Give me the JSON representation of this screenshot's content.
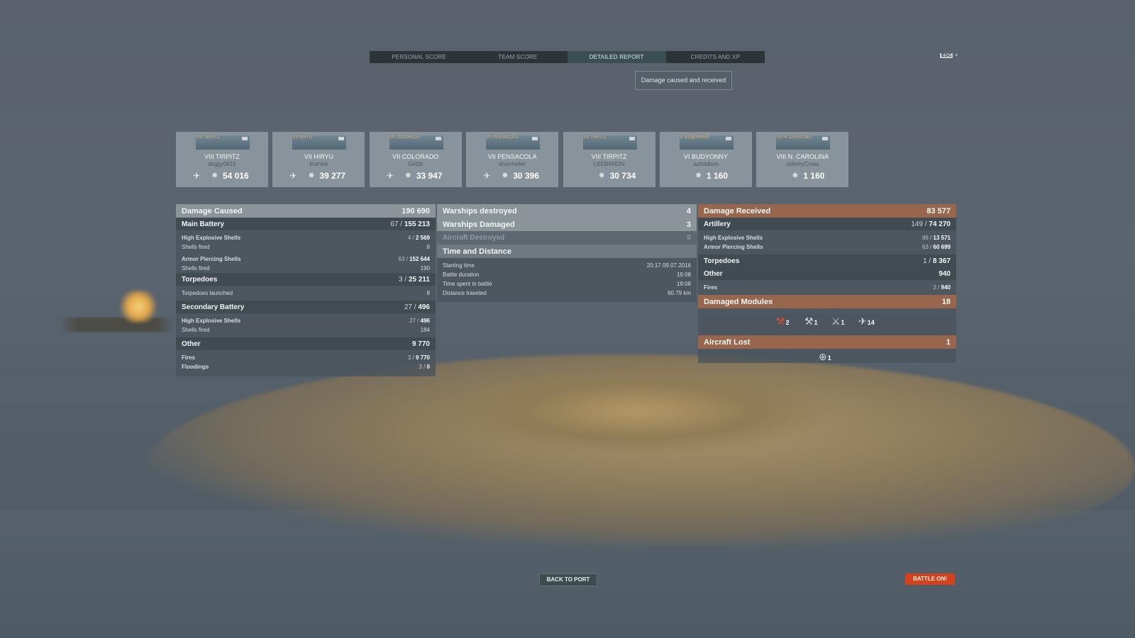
{
  "tabs": [
    "PERSONAL SCORE",
    "TEAM SCORE",
    "DETAILED REPORT",
    "CREDITS AND XP"
  ],
  "active_tab": "DETAILED REPORT",
  "esc_label": "ESC",
  "close_glyph": "×",
  "subtitle": "Damage caused and received",
  "cards": [
    {
      "ship": "VIII TIRPITZ",
      "player": "doggy0815",
      "damage": "54 016",
      "thumb_name": "VIII TIRPITZ"
    },
    {
      "ship": "VII HIRYU",
      "player": "frutnick",
      "damage": "39 277",
      "thumb_name": "VII HIRYU"
    },
    {
      "ship": "VII COLORADO",
      "player": "Girl2k",
      "damage": "33 947",
      "thumb_name": "VII COLORADO"
    },
    {
      "ship": "VII PENSACOLA",
      "player": "drumheller",
      "damage": "30 396",
      "thumb_name": "VII PENSACOLA"
    },
    {
      "ship": "VIII TIRPITZ",
      "player": "LEEBANON",
      "damage": "30 734",
      "thumb_name": "VIII TIRPITZ"
    },
    {
      "ship": "VI BUDYONNY",
      "player": "astradium",
      "damage": "1 160",
      "thumb_name": "VI БУДЕННЫЙ"
    },
    {
      "ship": "VIII N. CAROLINA",
      "player": "JohnnyCross",
      "damage": "1 160",
      "thumb_name": "VIII N. CAROLINA"
    }
  ],
  "damage_caused": {
    "label": "Damage Caused",
    "value": "190 690",
    "main_battery": {
      "label": "Main Battery",
      "hits": "67 /",
      "value": "155 213"
    },
    "he_shells": {
      "label": "High Explosive Shells",
      "hits": "4 /",
      "value": "2 569"
    },
    "he_fired": {
      "label": "Shells fired",
      "value": "8"
    },
    "ap_shells": {
      "label": "Armor Piercing Shells",
      "hits": "63 /",
      "value": "152 644"
    },
    "ap_fired": {
      "label": "Shells fired",
      "value": "190"
    },
    "torpedoes": {
      "label": "Torpedoes",
      "hits": "3 /",
      "value": "25 211"
    },
    "torp_launched": {
      "label": "Torpedoes launched",
      "value": "8"
    },
    "secondary": {
      "label": "Secondary Battery",
      "hits": "27 /",
      "value": "496"
    },
    "sec_he": {
      "label": "High Explosive Shells",
      "hits": "27 /",
      "value": "496"
    },
    "sec_fired": {
      "label": "Shells fired",
      "value": "184"
    },
    "other": {
      "label": "Other",
      "value": "9 770"
    },
    "fires": {
      "label": "Fires",
      "hits": "3 /",
      "value": "9 770"
    },
    "floodings": {
      "label": "Floodings",
      "hits": "3 /",
      "value": "0"
    }
  },
  "middle": {
    "destroyed": {
      "label": "Warships destroyed",
      "value": "4"
    },
    "damaged": {
      "label": "Warships Damaged",
      "value": "3"
    },
    "aircraft": {
      "label": "Aircraft Destroyed",
      "value": "0"
    },
    "time_header": "Time and Distance",
    "starting": {
      "label": "Starting time",
      "value": "20:17  09.07.2016"
    },
    "duration": {
      "label": "Battle duration",
      "value": "19:08"
    },
    "spent": {
      "label": "Time spent in battle",
      "value": "19:08"
    },
    "distance": {
      "label": "Distance traveled",
      "value": "60.79 km"
    }
  },
  "damage_received": {
    "label": "Damage Received",
    "value": "83 577",
    "artillery": {
      "label": "Artillery",
      "hits": "149 /",
      "value": "74 270"
    },
    "he_shells": {
      "label": "High Explosive Shells",
      "hits": "86 /",
      "value": "13 571"
    },
    "ap_shells": {
      "label": "Armor Piercing Shells",
      "hits": "63 /",
      "value": "60 699"
    },
    "torpedoes": {
      "label": "Torpedoes",
      "hits": "1 /",
      "value": "8 367"
    },
    "other": {
      "label": "Other",
      "value": "940"
    },
    "fires": {
      "label": "Fires",
      "hits": "2 /",
      "value": "940"
    }
  },
  "damaged_modules": {
    "label": "Damaged Modules",
    "value": "18",
    "items": [
      {
        "icon": "main-gun-icon",
        "count": "2"
      },
      {
        "icon": "secondary-gun-icon",
        "count": "1"
      },
      {
        "icon": "aa-gun-icon",
        "count": "1"
      },
      {
        "icon": "torpedo-tube-icon",
        "count": "14"
      }
    ]
  },
  "aircraft_lost": {
    "label": "Aircraft Lost",
    "value": "1",
    "count": "1"
  },
  "buttons": {
    "back": "BACK TO PORT",
    "battle": "BATTLE ON!"
  }
}
